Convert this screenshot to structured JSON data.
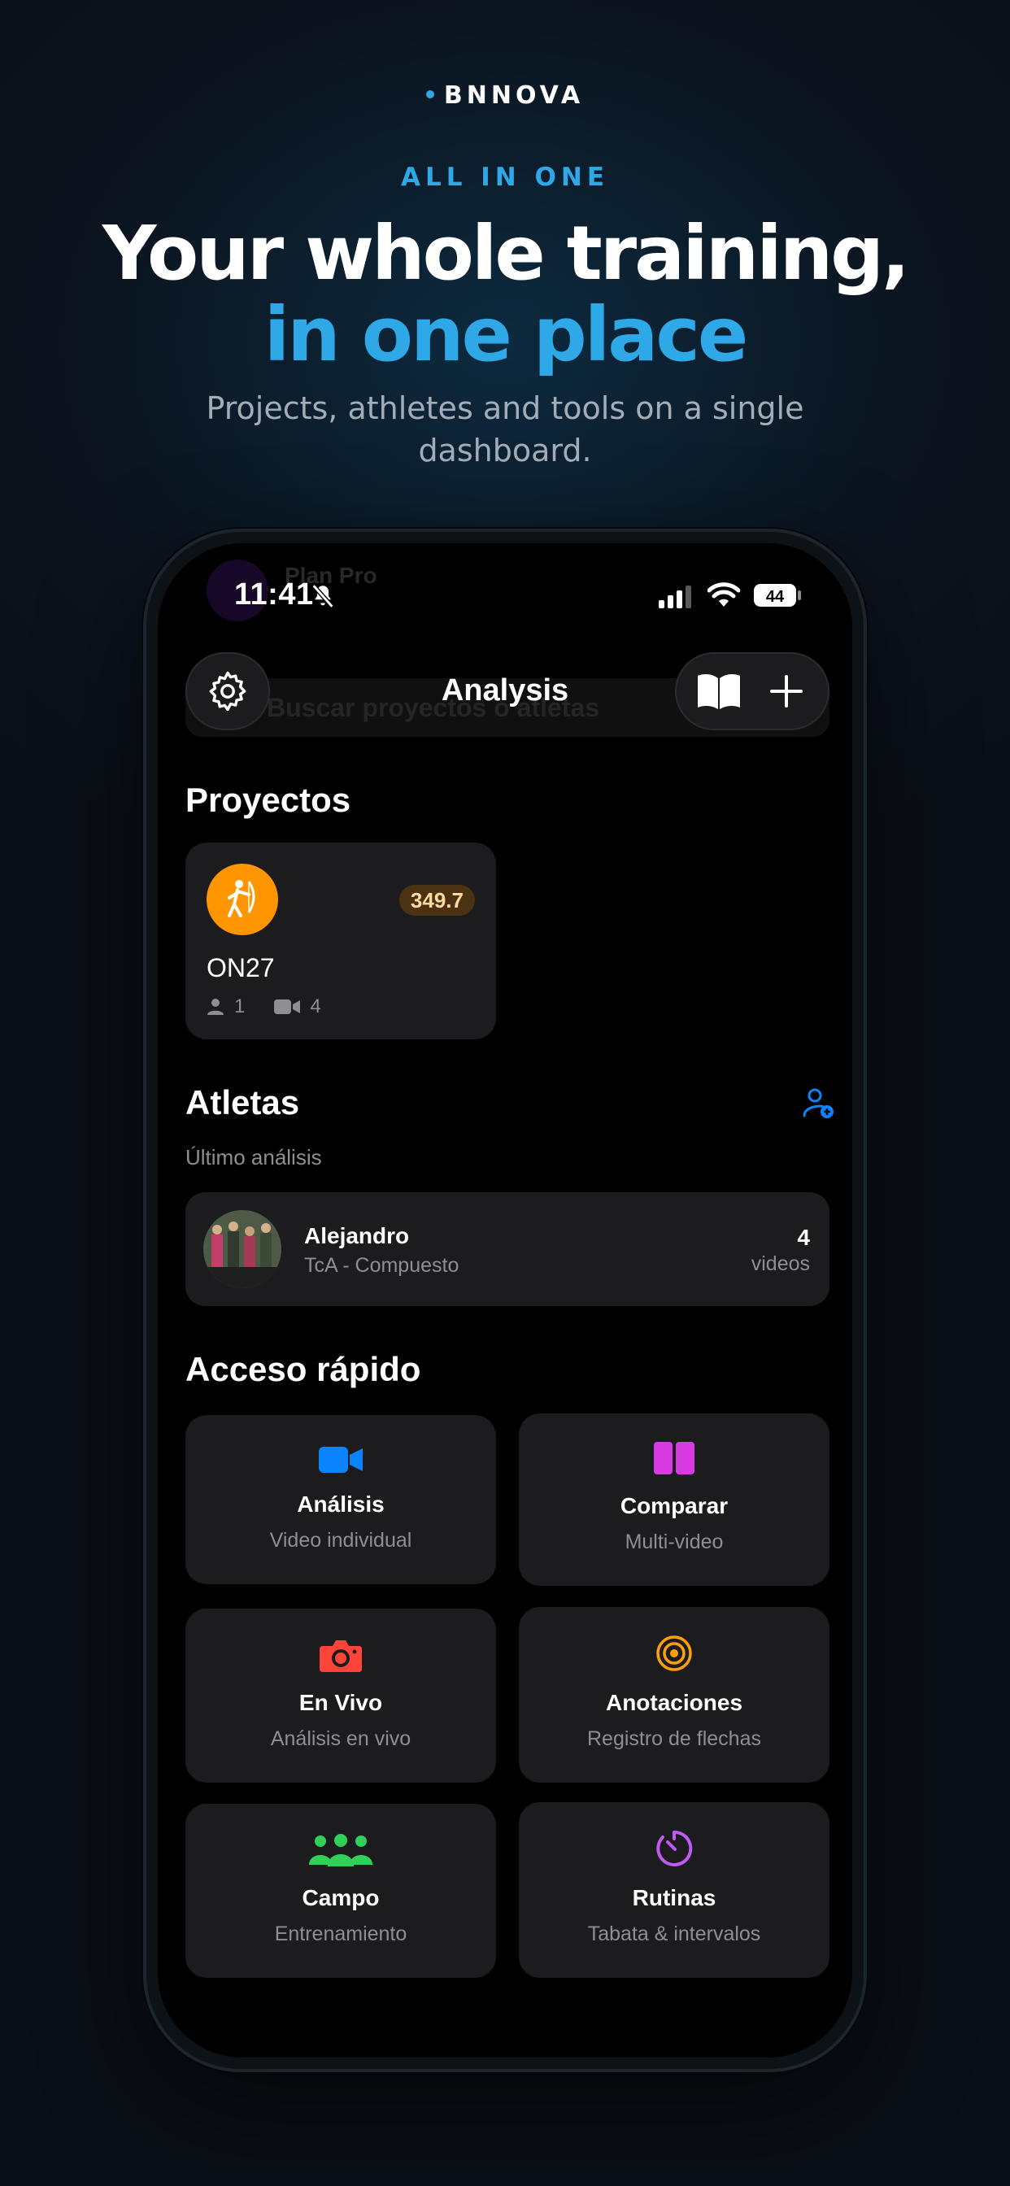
{
  "promo": {
    "brand": "BNNOVA",
    "eyebrow": "ALL IN ONE",
    "headline_line1": "Your whole training,",
    "headline_line2": "in one place",
    "subhead": "Projects, athletes and tools on a single dashboard."
  },
  "status_bar": {
    "time": "11:41",
    "battery": "44"
  },
  "background_ghost": {
    "title": "Plan Pro",
    "search_placeholder": "Buscar proyectos o atletas"
  },
  "nav": {
    "title": "Analysis"
  },
  "projects": {
    "section_title": "Proyectos",
    "items": [
      {
        "name": "ON27",
        "score": "349.7",
        "athletes": "1",
        "videos": "4",
        "icon": "archer-icon",
        "color": "#ff9500"
      }
    ]
  },
  "athletes": {
    "section_title": "Atletas",
    "subtitle": "Último análisis",
    "items": [
      {
        "name": "Alejandro",
        "detail": "TcA   - Compuesto",
        "count": "4",
        "unit": "videos"
      }
    ]
  },
  "quick_access": {
    "section_title": "Acceso rápido",
    "tiles": [
      {
        "title": "Análisis",
        "subtitle": "Video individual",
        "icon": "video-camera-icon",
        "color": "#0a84ff"
      },
      {
        "title": "Comparar",
        "subtitle": "Multi-video",
        "icon": "split-panels-icon",
        "color": "#d63ae0"
      },
      {
        "title": "En Vivo",
        "subtitle": "Análisis en vivo",
        "icon": "camera-icon",
        "color": "#ff453a"
      },
      {
        "title": "Anotaciones",
        "subtitle": "Registro de flechas",
        "icon": "target-icon",
        "color": "#ff9f0a"
      },
      {
        "title": "Campo",
        "subtitle": "Entrenamiento",
        "icon": "group-icon",
        "color": "#30d158"
      },
      {
        "title": "Rutinas",
        "subtitle": "Tabata & intervalos",
        "icon": "timer-icon",
        "color": "#bf5af2"
      }
    ]
  }
}
